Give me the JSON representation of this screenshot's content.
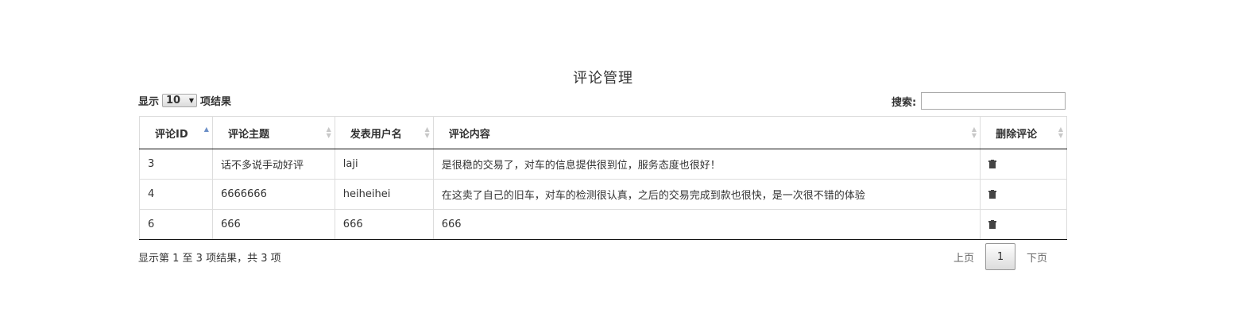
{
  "page": {
    "title": "评论管理"
  },
  "controls": {
    "length_prefix": "显示",
    "length_value": "10",
    "length_suffix": "项结果",
    "search_label": "搜索:",
    "search_value": ""
  },
  "table": {
    "columns": [
      {
        "label": "评论ID",
        "sort": "asc"
      },
      {
        "label": "评论主题",
        "sort": "both"
      },
      {
        "label": "发表用户名",
        "sort": "both"
      },
      {
        "label": "评论内容",
        "sort": "both"
      },
      {
        "label": "删除评论",
        "sort": "both"
      }
    ],
    "rows": [
      {
        "id": "3",
        "subject": "话不多说手动好评",
        "user": "laji",
        "content": "是很稳的交易了，对车的信息提供很到位，服务态度也很好！",
        "action_icon": "trash-icon"
      },
      {
        "id": "4",
        "subject": "6666666",
        "user": "heiheihei",
        "content": "在这卖了自己的旧车，对车的检测很认真，之后的交易完成到款也很快，是一次很不错的体验",
        "action_icon": "trash-icon"
      },
      {
        "id": "6",
        "subject": "666",
        "user": "666",
        "content": "666",
        "action_icon": "trash-icon"
      }
    ]
  },
  "footer": {
    "info": "显示第 1 至 3 项结果，共 3 项",
    "prev_label": "上页",
    "current_page": "1",
    "next_label": "下页"
  },
  "colors": {
    "sort_active": "#6b8fc7",
    "sort_inactive": "#c8c8c8",
    "border": "#dddddd",
    "header_rule": "#111111"
  }
}
